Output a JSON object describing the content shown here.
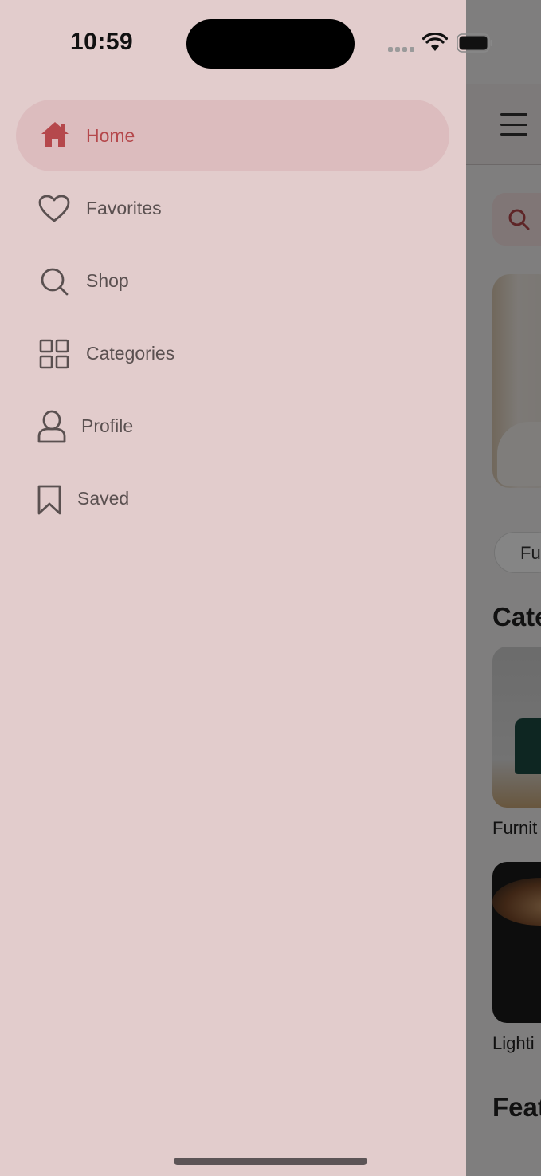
{
  "status_bar": {
    "time": "10:59"
  },
  "drawer": {
    "items": [
      {
        "label": "Home",
        "icon": "home-icon",
        "active": true
      },
      {
        "label": "Favorites",
        "icon": "heart-icon",
        "active": false
      },
      {
        "label": "Shop",
        "icon": "search-icon",
        "active": false
      },
      {
        "label": "Categories",
        "icon": "grid-icon",
        "active": false
      },
      {
        "label": "Profile",
        "icon": "user-icon",
        "active": false
      },
      {
        "label": "Saved",
        "icon": "bookmark-icon",
        "active": false
      }
    ]
  },
  "background": {
    "chip_label": "Fu",
    "categories_heading": "Cate",
    "card1_label": "Furnit",
    "card2_label": "Lighti",
    "featured_heading": "Feat"
  },
  "colors": {
    "drawer_bg": "#e2cccc",
    "active_pill": "#dcbcbe",
    "accent": "#b5484c",
    "text": "#5a5050"
  }
}
